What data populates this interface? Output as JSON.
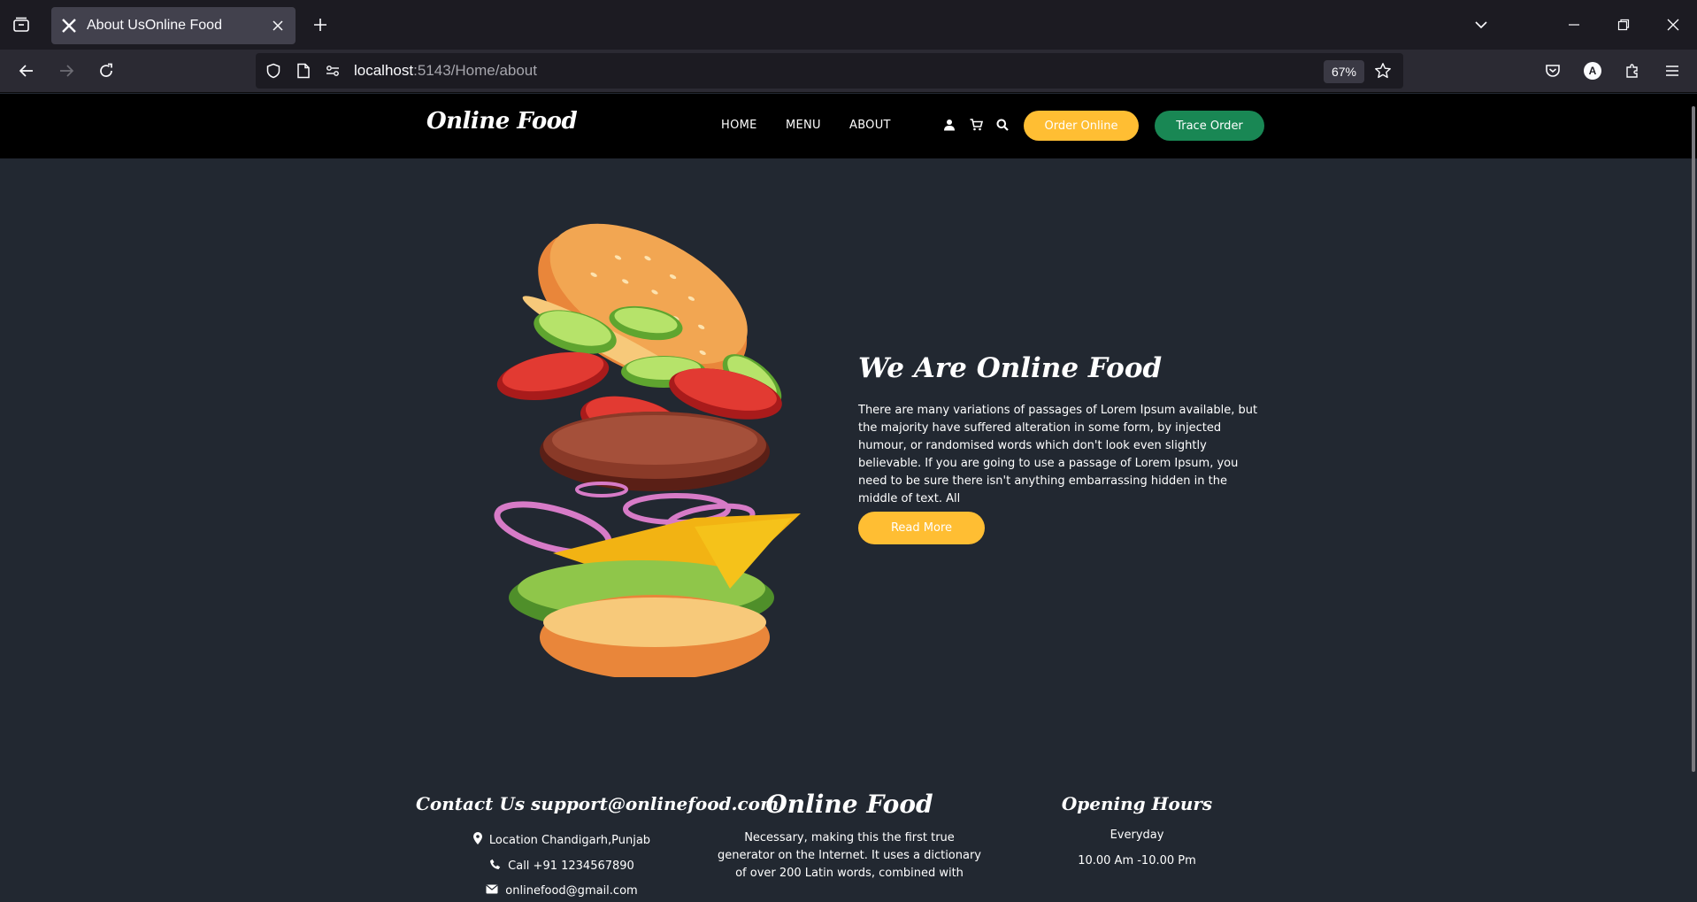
{
  "browser": {
    "tab_title": "About UsOnline Food",
    "url_host": "localhost",
    "url_path": ":5143/Home/about",
    "zoom": "67%"
  },
  "site": {
    "logo": "Online Food",
    "nav": {
      "home": "HOME",
      "menu": "MENU",
      "about": "ABOUT"
    },
    "order_button": "Order Online",
    "trace_button": "Trace Order"
  },
  "about": {
    "heading": "We Are Online Food",
    "body": "There are many variations of passages of Lorem Ipsum available, but the majority have suffered alteration in some form, by injected humour, or randomised words which don't look even slightly believable. If you are going to use a passage of Lorem Ipsum, you need to be sure there isn't anything embarrassing hidden in the middle of text. All",
    "read_more": "Read More"
  },
  "footer": {
    "contact_title": "Contact Us support@onlinefood.com",
    "location": "Location Chandigarh,Punjab",
    "phone": "Call +91 1234567890",
    "email": "onlinefood@gmail.com",
    "brand_title": "Online Food",
    "brand_text": "Necessary, making this the first true generator on the Internet. It uses a dictionary of over 200 Latin words, combined with",
    "hours_title": "Opening Hours",
    "hours_days": "Everyday",
    "hours_time": "10.00 Am -10.00 Pm"
  },
  "colors": {
    "accent": "#ffbe33",
    "trace": "#198754",
    "page_bg": "#222831",
    "header_bg": "#000000"
  }
}
